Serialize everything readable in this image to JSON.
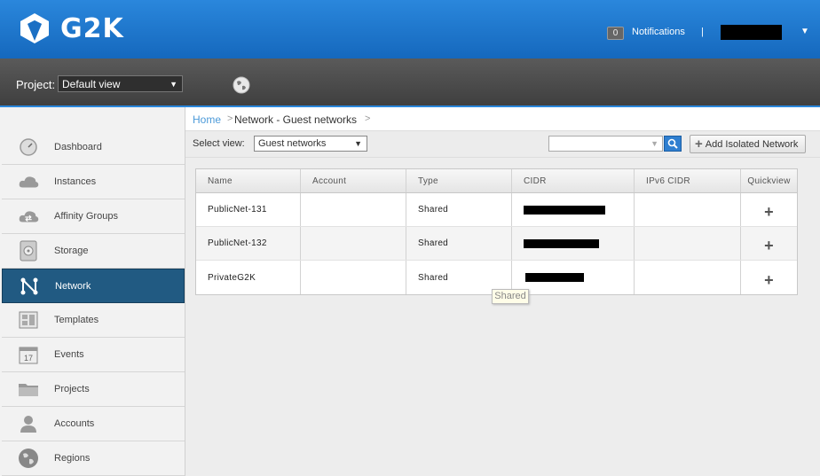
{
  "brand": {
    "logo_text": "G2K"
  },
  "header": {
    "notifications_count": "0",
    "notifications_label": "Notifications",
    "separator": "|",
    "user_name_redacted": true
  },
  "project_bar": {
    "label": "Project:",
    "selected": "Default view"
  },
  "sidebar": {
    "items": [
      {
        "label": "Dashboard",
        "icon": "dashboard-icon"
      },
      {
        "label": "Instances",
        "icon": "cloud-icon"
      },
      {
        "label": "Affinity Groups",
        "icon": "affinity-cloud-icon"
      },
      {
        "label": "Storage",
        "icon": "storage-disk-icon"
      },
      {
        "label": "Network",
        "icon": "network-icon",
        "active": true
      },
      {
        "label": "Templates",
        "icon": "templates-icon"
      },
      {
        "label": "Events",
        "icon": "calendar-icon"
      },
      {
        "label": "Projects",
        "icon": "folder-icon"
      },
      {
        "label": "Accounts",
        "icon": "user-icon"
      },
      {
        "label": "Regions",
        "icon": "globe-icon"
      }
    ]
  },
  "breadcrumb": {
    "home": "Home",
    "sep": ">",
    "current": "Network - Guest networks"
  },
  "toolbar": {
    "select_view_label": "Select view:",
    "select_view_value": "Guest networks",
    "search_placeholder": "",
    "add_button_label": "Add Isolated Network"
  },
  "table": {
    "columns": [
      "Name",
      "Account",
      "Type",
      "CIDR",
      "IPv6 CIDR",
      "Quickview"
    ],
    "rows": [
      {
        "name": "PublicNet-131",
        "account": "",
        "type": "Shared",
        "cidr_redacted": true,
        "ipv6_cidr": ""
      },
      {
        "name": "PublicNet-132",
        "account": "",
        "type": "Shared",
        "cidr_redacted": true,
        "ipv6_cidr": ""
      },
      {
        "name": "PrivateG2K",
        "account": "",
        "type": "Shared",
        "cidr_redacted": true,
        "ipv6_cidr": ""
      }
    ],
    "quickview_symbol": "+"
  },
  "tooltip": {
    "text": "Shared"
  },
  "colors": {
    "header_blue": "#1a6fc4",
    "active_nav": "#215a82",
    "link": "#4c9ad9"
  }
}
